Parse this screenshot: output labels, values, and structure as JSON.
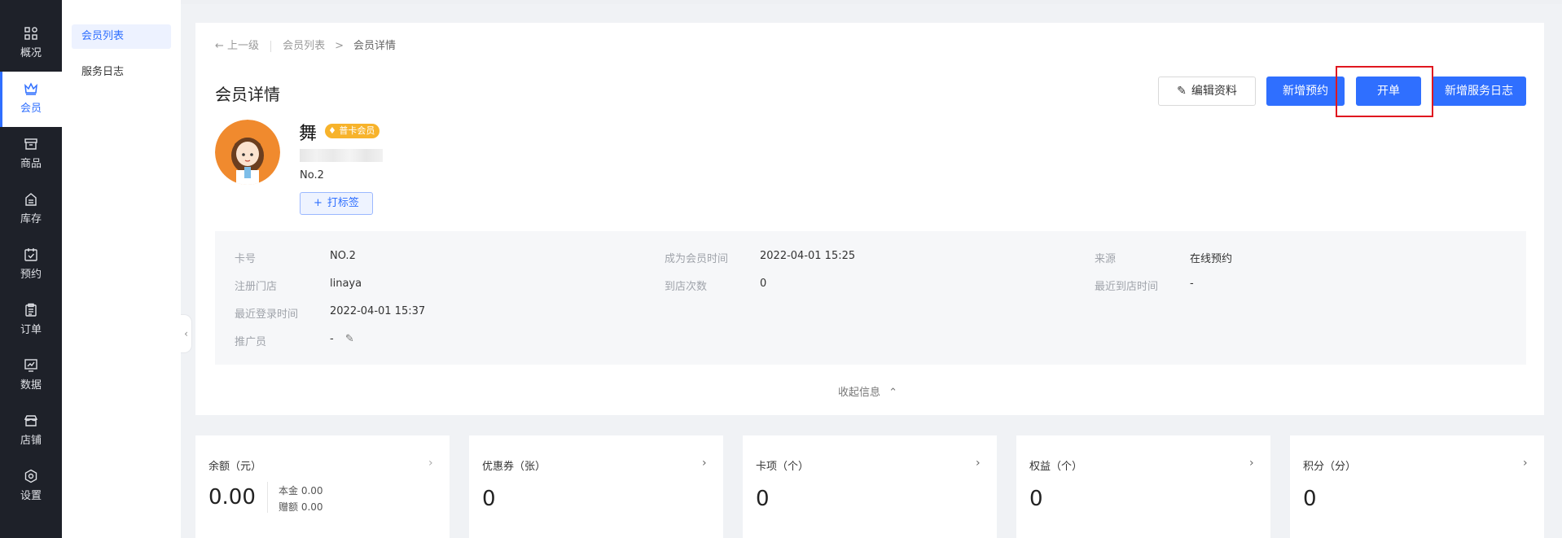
{
  "sidebar": {
    "items": [
      {
        "label": "概况",
        "icon": "dashboard-icon"
      },
      {
        "label": "会员",
        "icon": "crown-icon"
      },
      {
        "label": "商品",
        "icon": "box-icon"
      },
      {
        "label": "库存",
        "icon": "inventory-icon"
      },
      {
        "label": "预约",
        "icon": "calendar-check-icon"
      },
      {
        "label": "订单",
        "icon": "clipboard-icon"
      },
      {
        "label": "数据",
        "icon": "chart-icon"
      },
      {
        "label": "店铺",
        "icon": "store-icon"
      },
      {
        "label": "设置",
        "icon": "settings-icon"
      }
    ],
    "active_index": 1
  },
  "subnav": {
    "items": [
      {
        "label": "会员列表"
      },
      {
        "label": "服务日志"
      }
    ]
  },
  "breadcrumb": {
    "back": "上一级",
    "parent": "会员列表",
    "separator": ">",
    "current": "会员详情"
  },
  "header": {
    "title": "会员详情",
    "buttons": {
      "edit": "编辑资料",
      "new_booking": "新增预约",
      "open_order": "开单",
      "new_service_log": "新增服务日志"
    }
  },
  "member": {
    "name": "舞",
    "badge": "普卡会员",
    "number": "No.2",
    "tag_button": "打标签"
  },
  "info": {
    "card_no_label": "卡号",
    "card_no": "NO.2",
    "join_time_label": "成为会员时间",
    "join_time": "2022-04-01 15:25",
    "source_label": "来源",
    "source": "在线预约",
    "store_label": "注册门店",
    "store": "linaya",
    "visits_label": "到店次数",
    "visits": "0",
    "last_visit_label": "最近到店时间",
    "last_visit": "-",
    "last_login_label": "最近登录时间",
    "last_login": "2022-04-01 15:37",
    "promoter_label": "推广员",
    "promoter": "-",
    "collapse": "收起信息"
  },
  "stats": {
    "balance": {
      "title": "余额（元）",
      "value": "0.00",
      "principal": "本金 0.00",
      "gift": "赠额 0.00"
    },
    "coupons": {
      "title": "优惠券（张）",
      "value": "0"
    },
    "cards": {
      "title": "卡项（个）",
      "value": "0"
    },
    "benefits": {
      "title": "权益（个）",
      "value": "0"
    },
    "points": {
      "title": "积分（分）",
      "value": "0"
    }
  },
  "colors": {
    "primary": "#2f6fff",
    "sidebar_bg": "#1e2129",
    "highlight": "#e0171f",
    "badge": "#f7b32b"
  }
}
